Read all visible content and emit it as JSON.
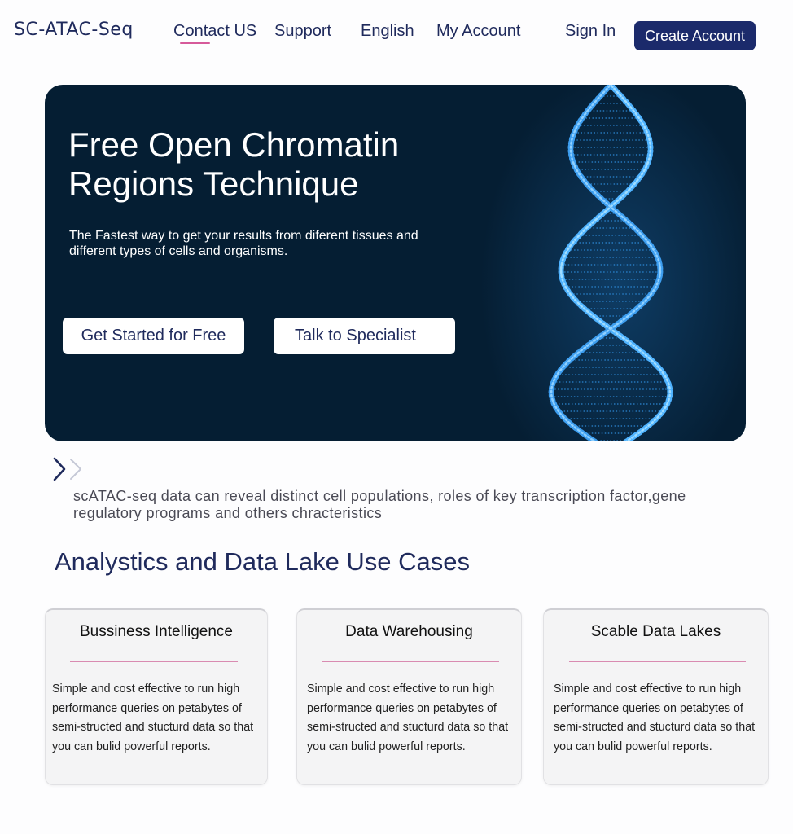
{
  "header": {
    "logo": "SC-ATAC-Seq",
    "nav": [
      "Contact US",
      "Support",
      "English",
      "My Account"
    ],
    "sign_in": "Sign In",
    "create_account": "Create Account",
    "accent_color": "#1b2a6b",
    "underline_color": "#d65a9a"
  },
  "hero": {
    "title": "Free Open Chromatin Regions Technique",
    "subtitle": "The Fastest way to get your results from diferent tissues and different types of cells and organisms.",
    "primary_button": "Get Started for Free",
    "secondary_button": "Talk to Specialist",
    "background_color": "#051e33",
    "image": "dna-helix"
  },
  "description": {
    "icon": "double-chevron-right-icon",
    "text": "scATAC-seq data can reveal distinct cell populations, roles of key transcription factor,gene regulatory programs and others chracteristics"
  },
  "use_cases": {
    "title": "Analystics and Data Lake Use Cases",
    "cards": [
      {
        "title": "Bussiness Intelligence",
        "body": "Simple and cost effective to run high performance queries on petabytes of semi-structed and stucturd data so that you can bulid powerful reports."
      },
      {
        "title": "Data Warehousing",
        "body": "Simple and cost effective to run high performance queries on petabytes of semi-structed and stucturd data so that you can bulid powerful reports."
      },
      {
        "title": "Scable Data Lakes",
        "body": "Simple and cost effective to run high performance queries on petabytes of semi-structed and stucturd data so that you can bulid powerful reports."
      }
    ]
  }
}
